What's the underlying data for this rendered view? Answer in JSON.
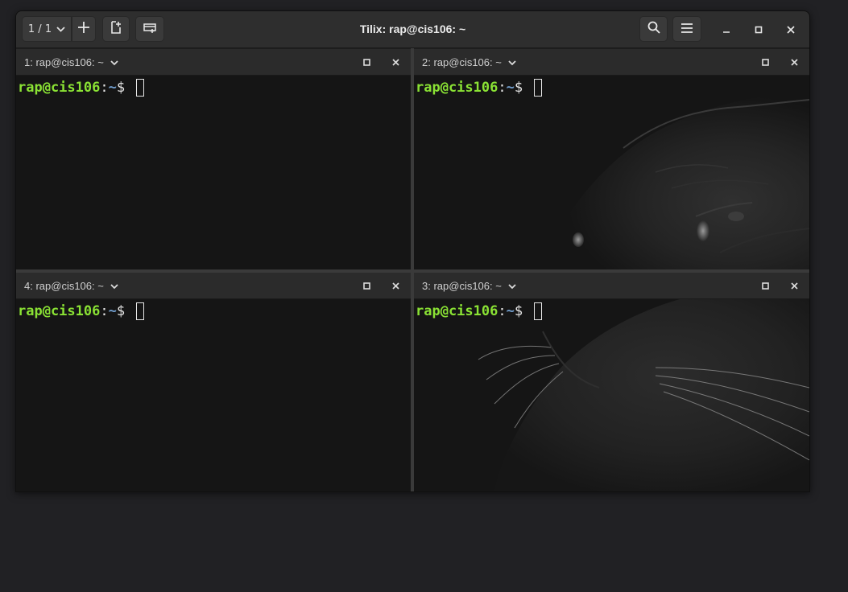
{
  "window": {
    "title": "Tilix: rap@cis106: ~",
    "session_switcher": "1 / 1"
  },
  "icons": {
    "session_dropdown": "chevron-down-icon",
    "add_terminal": "plus-icon",
    "new_session": "add-document-icon",
    "sidebar": "add-window-icon",
    "search": "search-icon",
    "menu": "hamburger-menu-icon",
    "minimize": "minimize-icon",
    "maximize": "maximize-icon",
    "close": "close-icon"
  },
  "terminals": [
    {
      "title": "1: rap@cis106: ~",
      "prompt_user": "rap@cis106",
      "prompt_sep": ":",
      "prompt_path": "~",
      "prompt_sign": "$"
    },
    {
      "title": "2: rap@cis106: ~",
      "prompt_user": "rap@cis106",
      "prompt_sep": ":",
      "prompt_path": "~",
      "prompt_sign": "$"
    },
    {
      "title": "4: rap@cis106: ~",
      "prompt_user": "rap@cis106",
      "prompt_sep": ":",
      "prompt_path": "~",
      "prompt_sign": "$"
    },
    {
      "title": "3: rap@cis106: ~",
      "prompt_user": "rap@cis106",
      "prompt_sep": ":",
      "prompt_path": "~",
      "prompt_sign": "$"
    }
  ],
  "colors": {
    "prompt_user": "#8ae234",
    "prompt_path": "#729fcf",
    "terminal_bg": "#151515",
    "headerbar_bg": "#2e2e2e"
  }
}
